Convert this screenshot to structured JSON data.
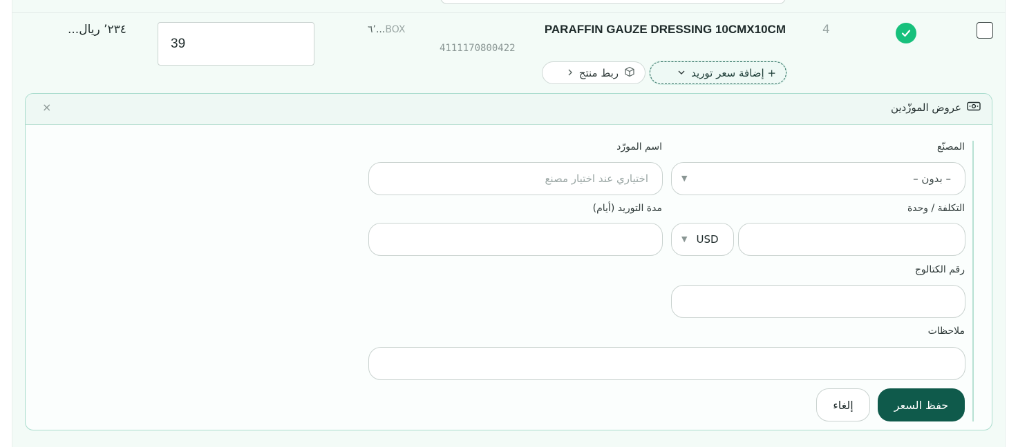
{
  "row": {
    "index": "4",
    "product_name": "PARAFFIN GAUZE DRESSING 10CMX10CM",
    "product_code": "4111170800422",
    "unit": "BOX",
    "unit_price": "٦’...",
    "quantity": "39",
    "total": "...٢٣٤’ ريال",
    "status": "matched",
    "link_product_label": "ربط منتج",
    "add_supply_price_label": "+ إضافة سعر توريد"
  },
  "panel": {
    "title": "عروض الموزّدين",
    "close_label": "×",
    "manufacturer_label": "المصنّع",
    "manufacturer_value": "– بدون –",
    "supplier_name_label": "اسم المورّد",
    "supplier_name_placeholder": "اختياري عند اختيار مصنع",
    "cost_label": "التكلفة / وحدة",
    "currency_value": "USD",
    "lead_time_label": "مدة التوريد (أيام)",
    "catalog_label": "رقم الكتالوج",
    "notes_label": "ملاحظات",
    "save_label": "حفظ السعر",
    "cancel_label": "إلغاء"
  },
  "colors": {
    "accent": "#0f5a4b",
    "status_ok": "#17c07c",
    "row_bg": "#f3fbf7",
    "panel_border": "#a9dccd"
  }
}
